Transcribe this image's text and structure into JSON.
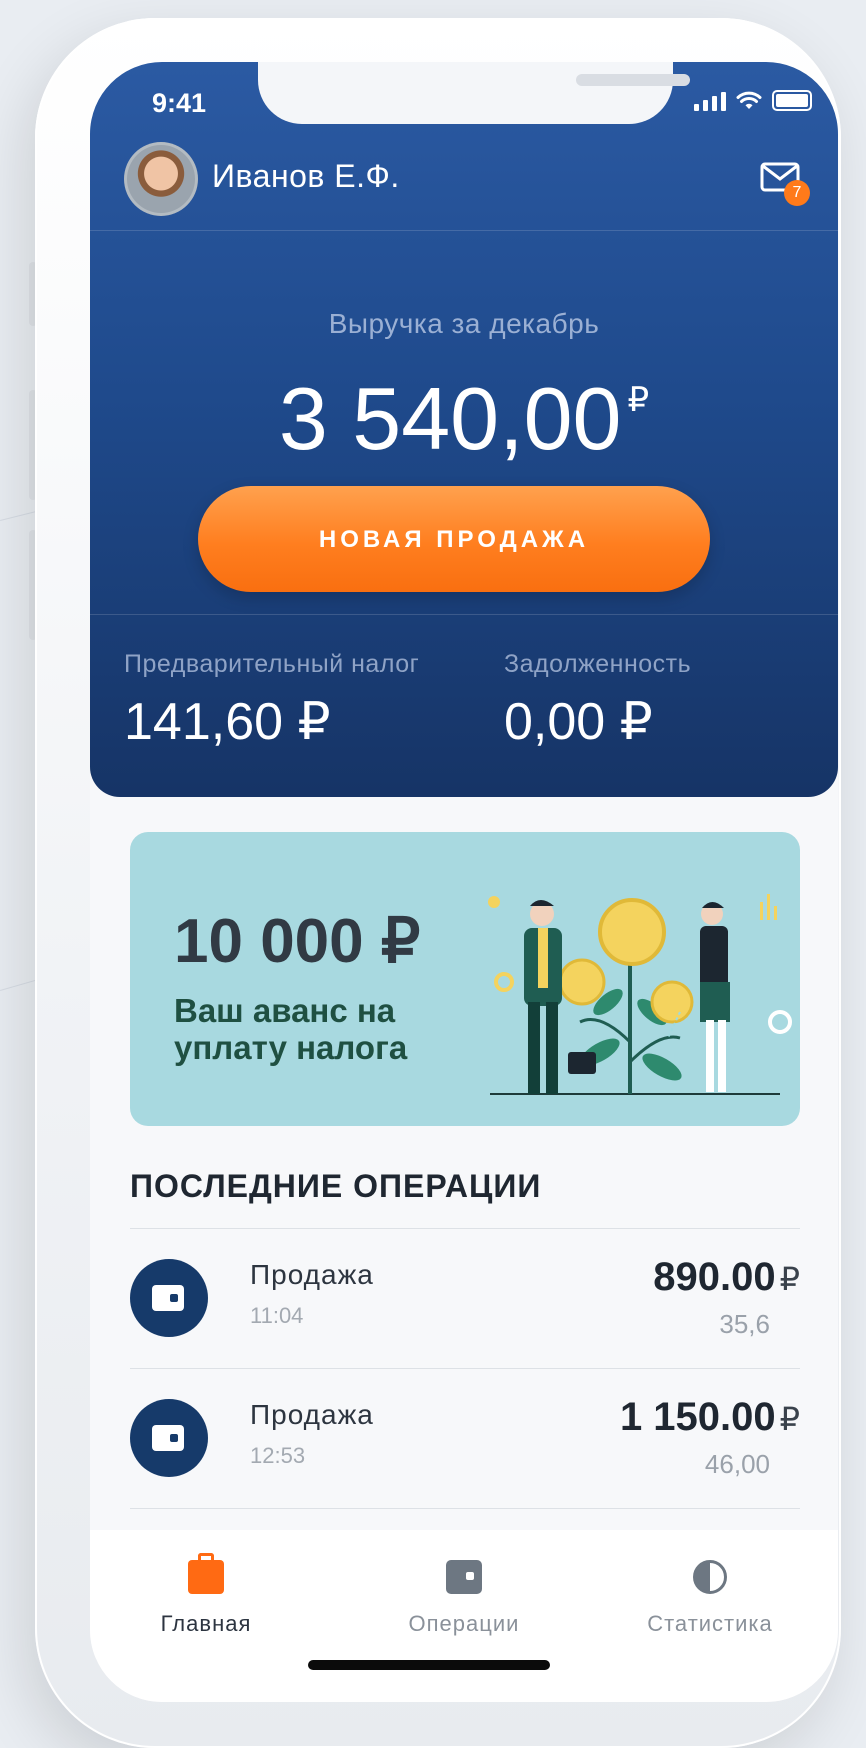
{
  "status_bar": {
    "time": "9:41"
  },
  "header": {
    "user_name": "Иванов Е.Ф.",
    "notifications_count": "7"
  },
  "revenue": {
    "label": "Выручка за декабрь",
    "amount": "3 540,00",
    "currency": "₽"
  },
  "new_sale_button": {
    "label": "НОВАЯ ПРОДАЖА"
  },
  "tax": {
    "preliminary_label": "Предварительный налог",
    "preliminary_value": "141,60 ₽",
    "debt_label": "Задолженность",
    "debt_value": "0,00 ₽"
  },
  "promo": {
    "amount": "10 000 ₽",
    "text": "Ваш аванс на уплату налога"
  },
  "operations": {
    "title": "ПОСЛЕДНИЕ ОПЕРАЦИИ",
    "items": [
      {
        "title": "Продажа",
        "time": "11:04",
        "amount": "890.00",
        "currency": "₽",
        "sub": "35,6"
      },
      {
        "title": "Продажа",
        "time": "12:53",
        "amount": "1 150.00",
        "currency": "₽",
        "sub": "46,00"
      }
    ]
  },
  "tabbar": {
    "items": [
      {
        "label": "Главная",
        "icon": "briefcase-icon",
        "active": true
      },
      {
        "label": "Операции",
        "icon": "wallet-icon",
        "active": false
      },
      {
        "label": "Статистика",
        "icon": "pie-chart-icon",
        "active": false
      }
    ]
  },
  "colors": {
    "hero_blue": "#1f4a8c",
    "accent_orange": "#ff7e1f",
    "promo_bg": "#a8d9e0",
    "op_icon_bg": "#163a6a"
  }
}
